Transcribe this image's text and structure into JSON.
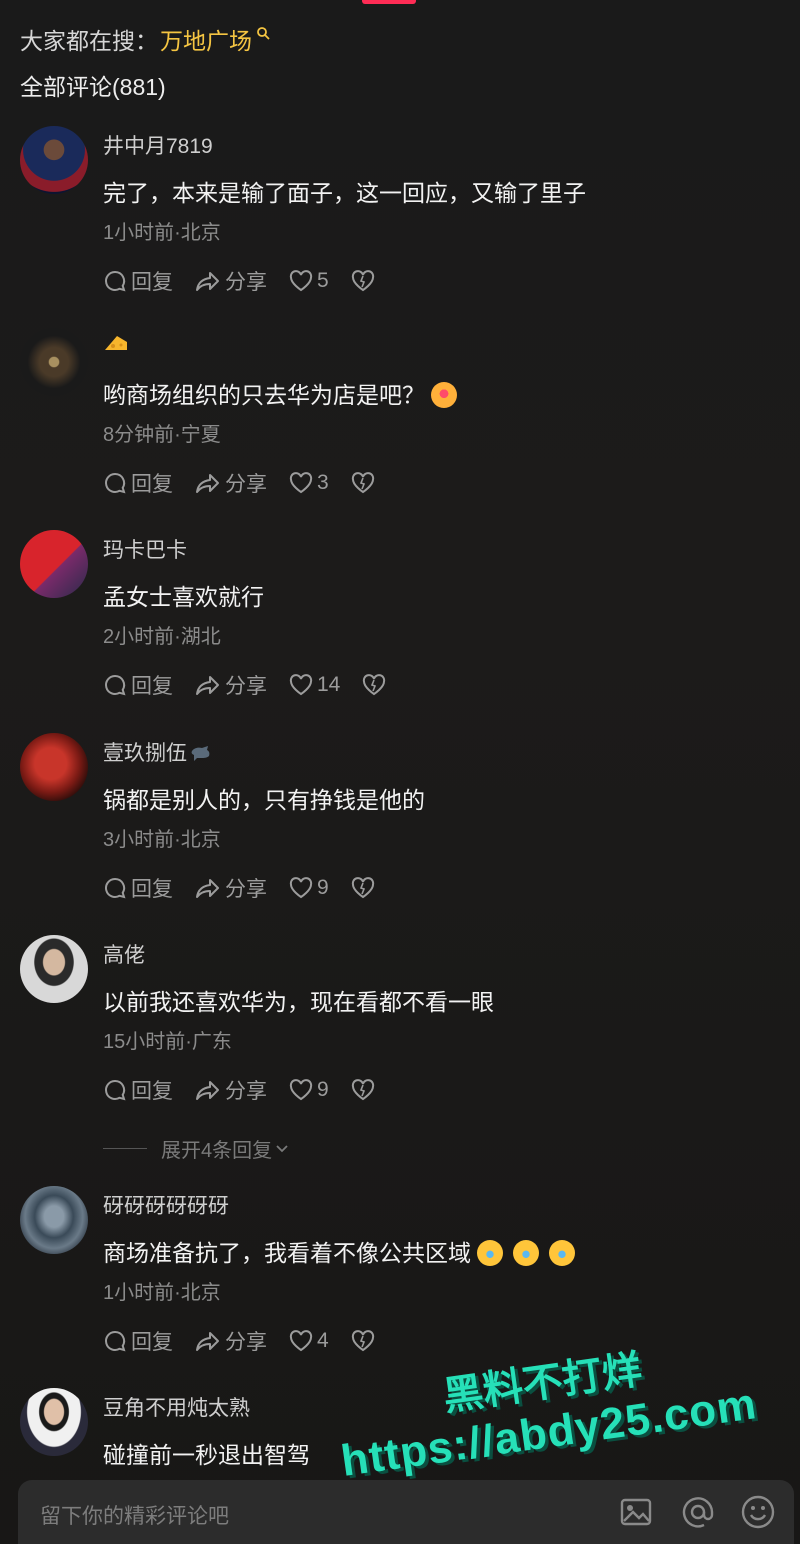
{
  "header": {
    "search_prefix": "大家都在搜：",
    "search_keyword": "万地广场",
    "comment_count_title": "全部评论(881)"
  },
  "comments": [
    {
      "username": "井中月7819",
      "content": "完了，本来是输了面子，这一回应，又输了里子",
      "meta": "1小时前·北京",
      "reply": "回复",
      "share": "分享",
      "likes": "5"
    },
    {
      "username": "",
      "content": "哟商场组织的只去华为店是吧？",
      "meta": "8分钟前·宁夏",
      "reply": "回复",
      "share": "分享",
      "likes": "3"
    },
    {
      "username": "玛卡巴卡",
      "content": "孟女士喜欢就行",
      "meta": "2小时前·湖北",
      "reply": "回复",
      "share": "分享",
      "likes": "14"
    },
    {
      "username": "壹玖捌伍",
      "content": "锅都是别人的，只有挣钱是他的",
      "meta": "3小时前·北京",
      "reply": "回复",
      "share": "分享",
      "likes": "9"
    },
    {
      "username": "高佬",
      "content": "以前我还喜欢华为，现在看都不看一眼",
      "meta": "15小时前·广东",
      "reply": "回复",
      "share": "分享",
      "likes": "9"
    },
    {
      "username": "砑砑砑砑砑砑",
      "content": "商场准备抗了，我看着不像公共区域",
      "meta": "1小时前·北京",
      "reply": "回复",
      "share": "分享",
      "likes": "4"
    },
    {
      "username": "豆角不用炖太熟",
      "content": "碰撞前一秒退出智驾",
      "meta": "",
      "reply": "",
      "share": "",
      "likes": ""
    }
  ],
  "expand_replies": "展开4条回复",
  "watermark": {
    "line1": "黑料不打烊",
    "line2": "https://abdy25.com"
  },
  "input": {
    "placeholder": "留下你的精彩评论吧"
  },
  "colors": {
    "accent": "#fe2c55",
    "keyword": "#f5c542",
    "watermark": "#26e0b8"
  },
  "icons": [
    "search-icon",
    "comment-icon",
    "share-icon",
    "heart-icon",
    "dislike-icon",
    "image-icon",
    "at-icon",
    "emoji-icon"
  ]
}
